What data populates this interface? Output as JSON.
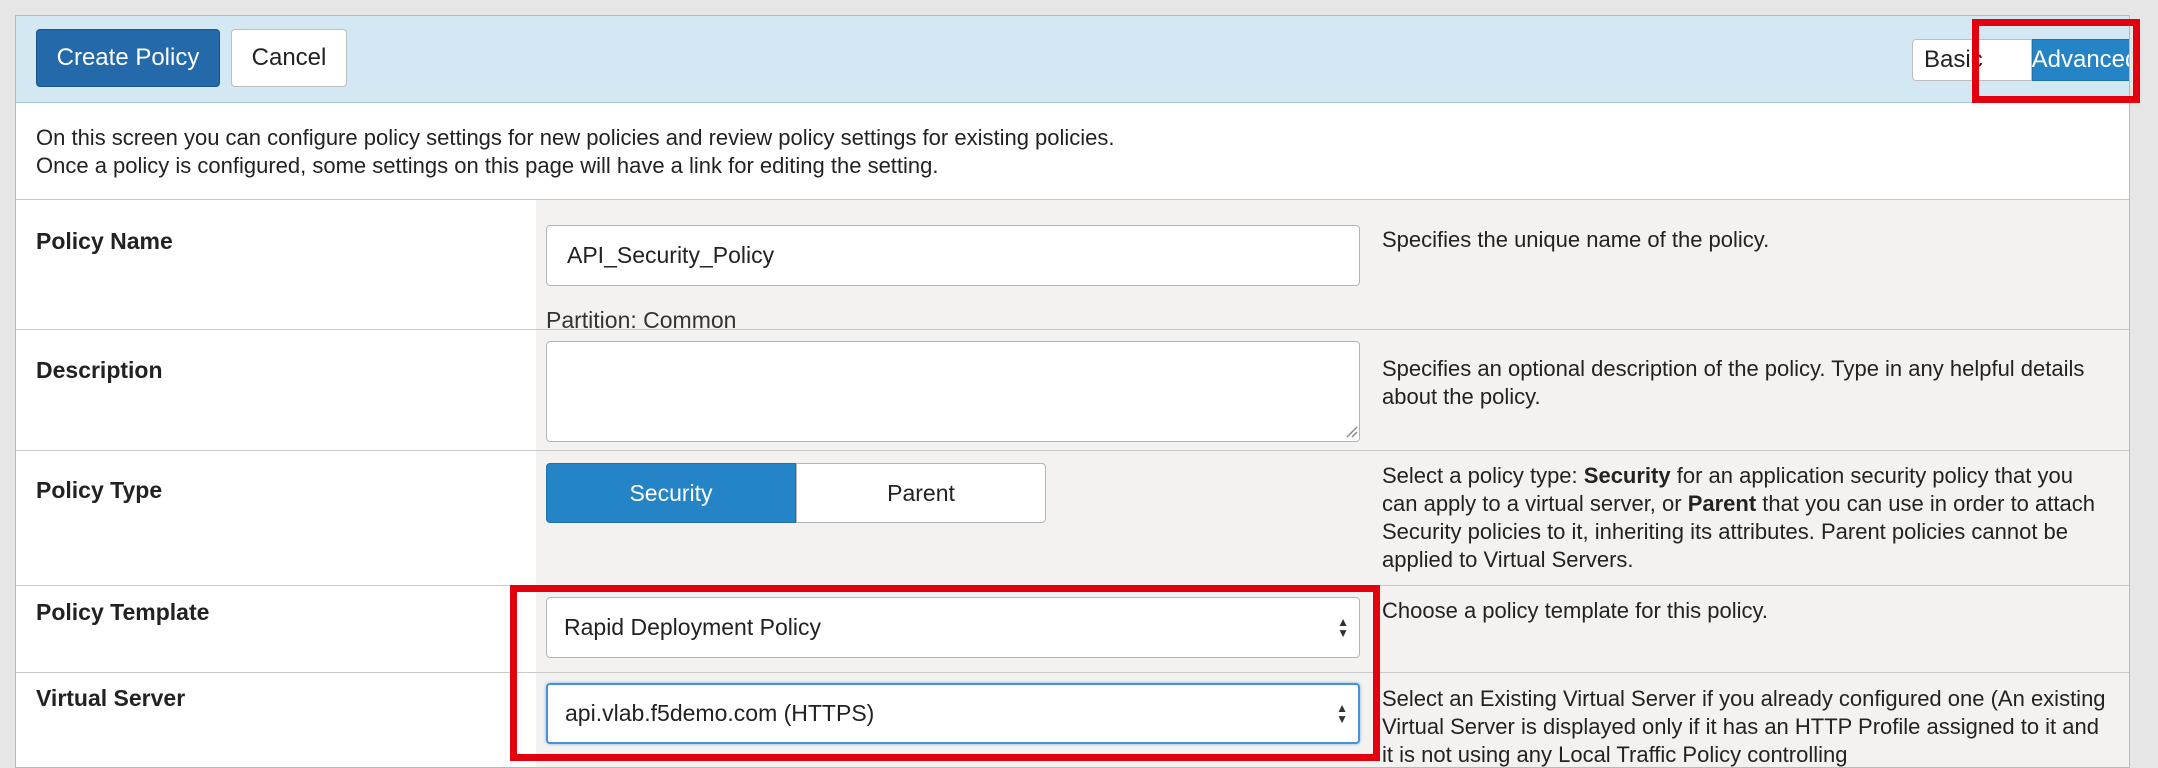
{
  "toolbar": {
    "create_label": "Create Policy",
    "cancel_label": "Cancel",
    "view_toggle": {
      "basic_label": "Basic",
      "advanced_label": "Advanced",
      "selected": "Advanced"
    }
  },
  "intro": {
    "line1": "On this screen you can configure policy settings for new policies and review policy settings for existing policies.",
    "line2": "Once a policy is configured, some settings on this page will have a link for editing the setting."
  },
  "rows": {
    "policy_name": {
      "label": "Policy Name",
      "value": "API_Security_Policy",
      "partition": "Partition: Common",
      "help": "Specifies the unique name of the policy."
    },
    "description": {
      "label": "Description",
      "value": "",
      "help": "Specifies an optional description of the policy. Type in any helpful details about the policy."
    },
    "policy_type": {
      "label": "Policy Type",
      "options": [
        "Security",
        "Parent"
      ],
      "selected": "Security",
      "help_pre": "Select a policy type: ",
      "help_bold1": "Security",
      "help_mid": " for an application security policy that you can apply to a virtual server, or ",
      "help_bold2": "Parent",
      "help_post": " that you can use in order to attach Security policies to it, inheriting its attributes. Parent policies cannot be applied to Virtual Servers."
    },
    "policy_template": {
      "label": "Policy Template",
      "value": "Rapid Deployment Policy",
      "help": "Choose a policy template for this policy."
    },
    "virtual_server": {
      "label": "Virtual Server",
      "value": "api.vlab.f5demo.com (HTTPS)",
      "help": "Select an Existing Virtual Server if you already configured one (An existing Virtual Server is displayed only if it has an HTTP Profile assigned to it and it is not using any Local Traffic Policy controlling"
    }
  },
  "icons": {
    "select_caret": "up-down-caret-icon",
    "resize": "resize-handle-icon"
  },
  "colors": {
    "primary": "#2469a9",
    "accent": "#2584c6",
    "highlight": "#e3000f",
    "toolbar_bg": "#d4e8f4"
  }
}
